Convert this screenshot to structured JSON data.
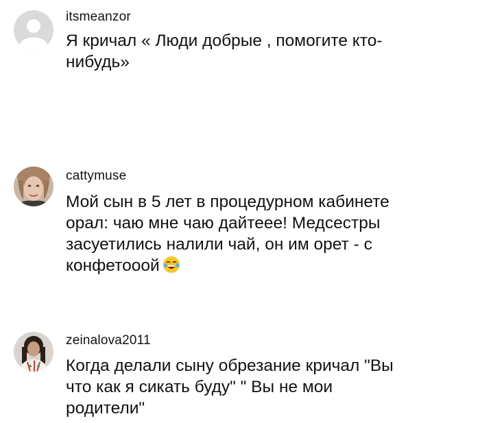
{
  "comments": [
    {
      "username": "itsmeanzor",
      "text": "Я кричал « Люди добрые , помогите кто-нибудь»",
      "avatar_icon": "default-avatar-icon",
      "has_emoji": false
    },
    {
      "username": "cattymuse",
      "text": "Мой сын в 5 лет в процедурном кабинете орал: чаю мне чаю дайтеее! Медсестры засуетились налили чай, он им орет - с конфетооой",
      "avatar_icon": "user-photo-avatar",
      "has_emoji": true,
      "emoji_icon": "laughing-face-emoji"
    },
    {
      "username": "zeinalova2011",
      "text": "Когда делали сыну обрезание кричал \"Вы что как я сикать буду\" \" Вы не мои родители\"",
      "avatar_icon": "user-photo-avatar",
      "has_emoji": false
    }
  ],
  "colors": {
    "text": "#111111",
    "background": "#ffffff",
    "default_avatar_bg": "#d9d9d9"
  }
}
